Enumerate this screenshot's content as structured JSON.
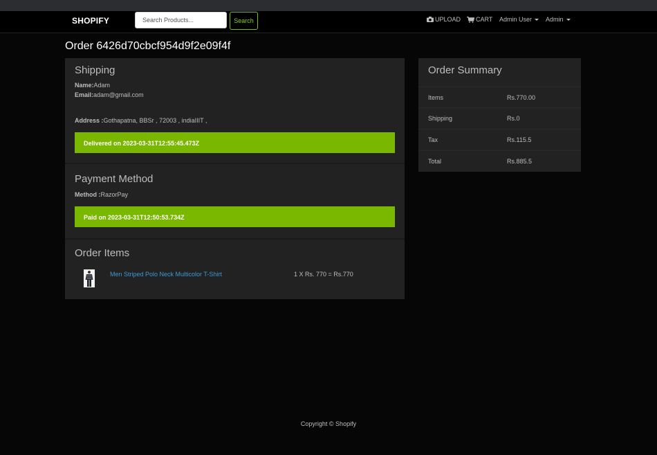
{
  "navbar": {
    "brand": "SHOPIFY",
    "search_placeholder": "Search Products...",
    "search_button": "Search",
    "upload_label": "UPLOAD",
    "cart_label": "CART",
    "user_menu_label": "Admin User",
    "admin_menu_label": "Admin"
  },
  "order": {
    "title": "Order 6426d70cbcf954d9f2e09f4f"
  },
  "shipping": {
    "heading": "Shipping",
    "name_label": "Name:",
    "name_value": "Adam",
    "email_label": "Email:",
    "email_value": "adam@gmail.com",
    "address_label": "Address :",
    "address_value": "Gothapatna, BBSr , 72003 , indiaIIIT ,",
    "delivered_status": "Delivered on 2023-03-31T12:55:45.473Z"
  },
  "payment": {
    "heading": "Payment Method",
    "method_label": "Method :",
    "method_value": "RazorPay",
    "paid_status": "Paid on 2023-03-31T12:50:53.734Z"
  },
  "order_items": {
    "heading": "Order Items",
    "items": [
      {
        "name": "Men Striped Polo Neck Multicolor T-Shirt",
        "price_line": "1 X Rs. 770 = Rs.770"
      }
    ]
  },
  "summary": {
    "heading": "Order Summary",
    "rows": [
      {
        "label": "Items",
        "value": "Rs.770.00"
      },
      {
        "label": "Shipping",
        "value": "Rs.0"
      },
      {
        "label": "Tax",
        "value": "Rs.115.5"
      },
      {
        "label": "Total",
        "value": "Rs.885.5"
      }
    ]
  },
  "footer": {
    "copyright": "Copyright © Shopify"
  },
  "colors": {
    "accent_green": "#7ab800",
    "link_blue": "#3c9ad6",
    "card_bg": "#222222",
    "page_bg": "#060606"
  }
}
